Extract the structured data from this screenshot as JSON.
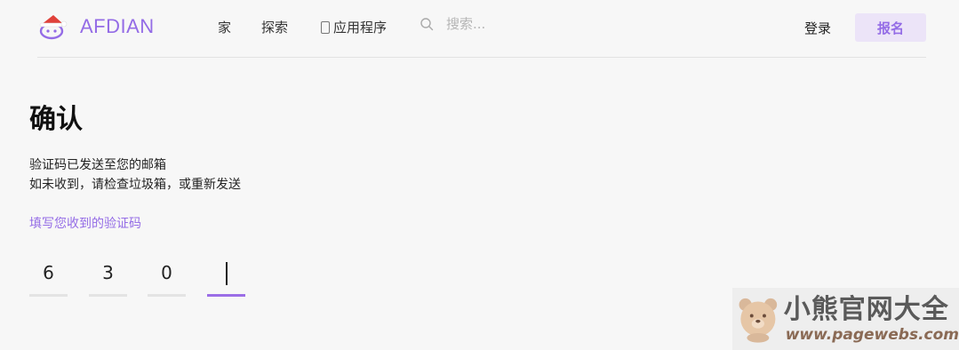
{
  "header": {
    "brand": "AFDIAN",
    "nav": {
      "home": "家",
      "explore": "探索",
      "app": "应用程序"
    },
    "search": {
      "placeholder": "搜索..."
    },
    "login": "登录",
    "signup": "报名"
  },
  "main": {
    "title": "确认",
    "description_line1": "验证码已发送至您的邮箱",
    "description_line2": "如未收到，请检查垃圾箱，或重新发送",
    "prompt": "填写您收到的验证码",
    "code": [
      "6",
      "3",
      "0",
      ""
    ]
  },
  "watermark": {
    "name": "小熊官网大全",
    "url": "www.pagewebs.com"
  },
  "colors": {
    "accent": "#946ce6",
    "signup_bg": "#ece4f8",
    "background": "#f7f7f7"
  }
}
